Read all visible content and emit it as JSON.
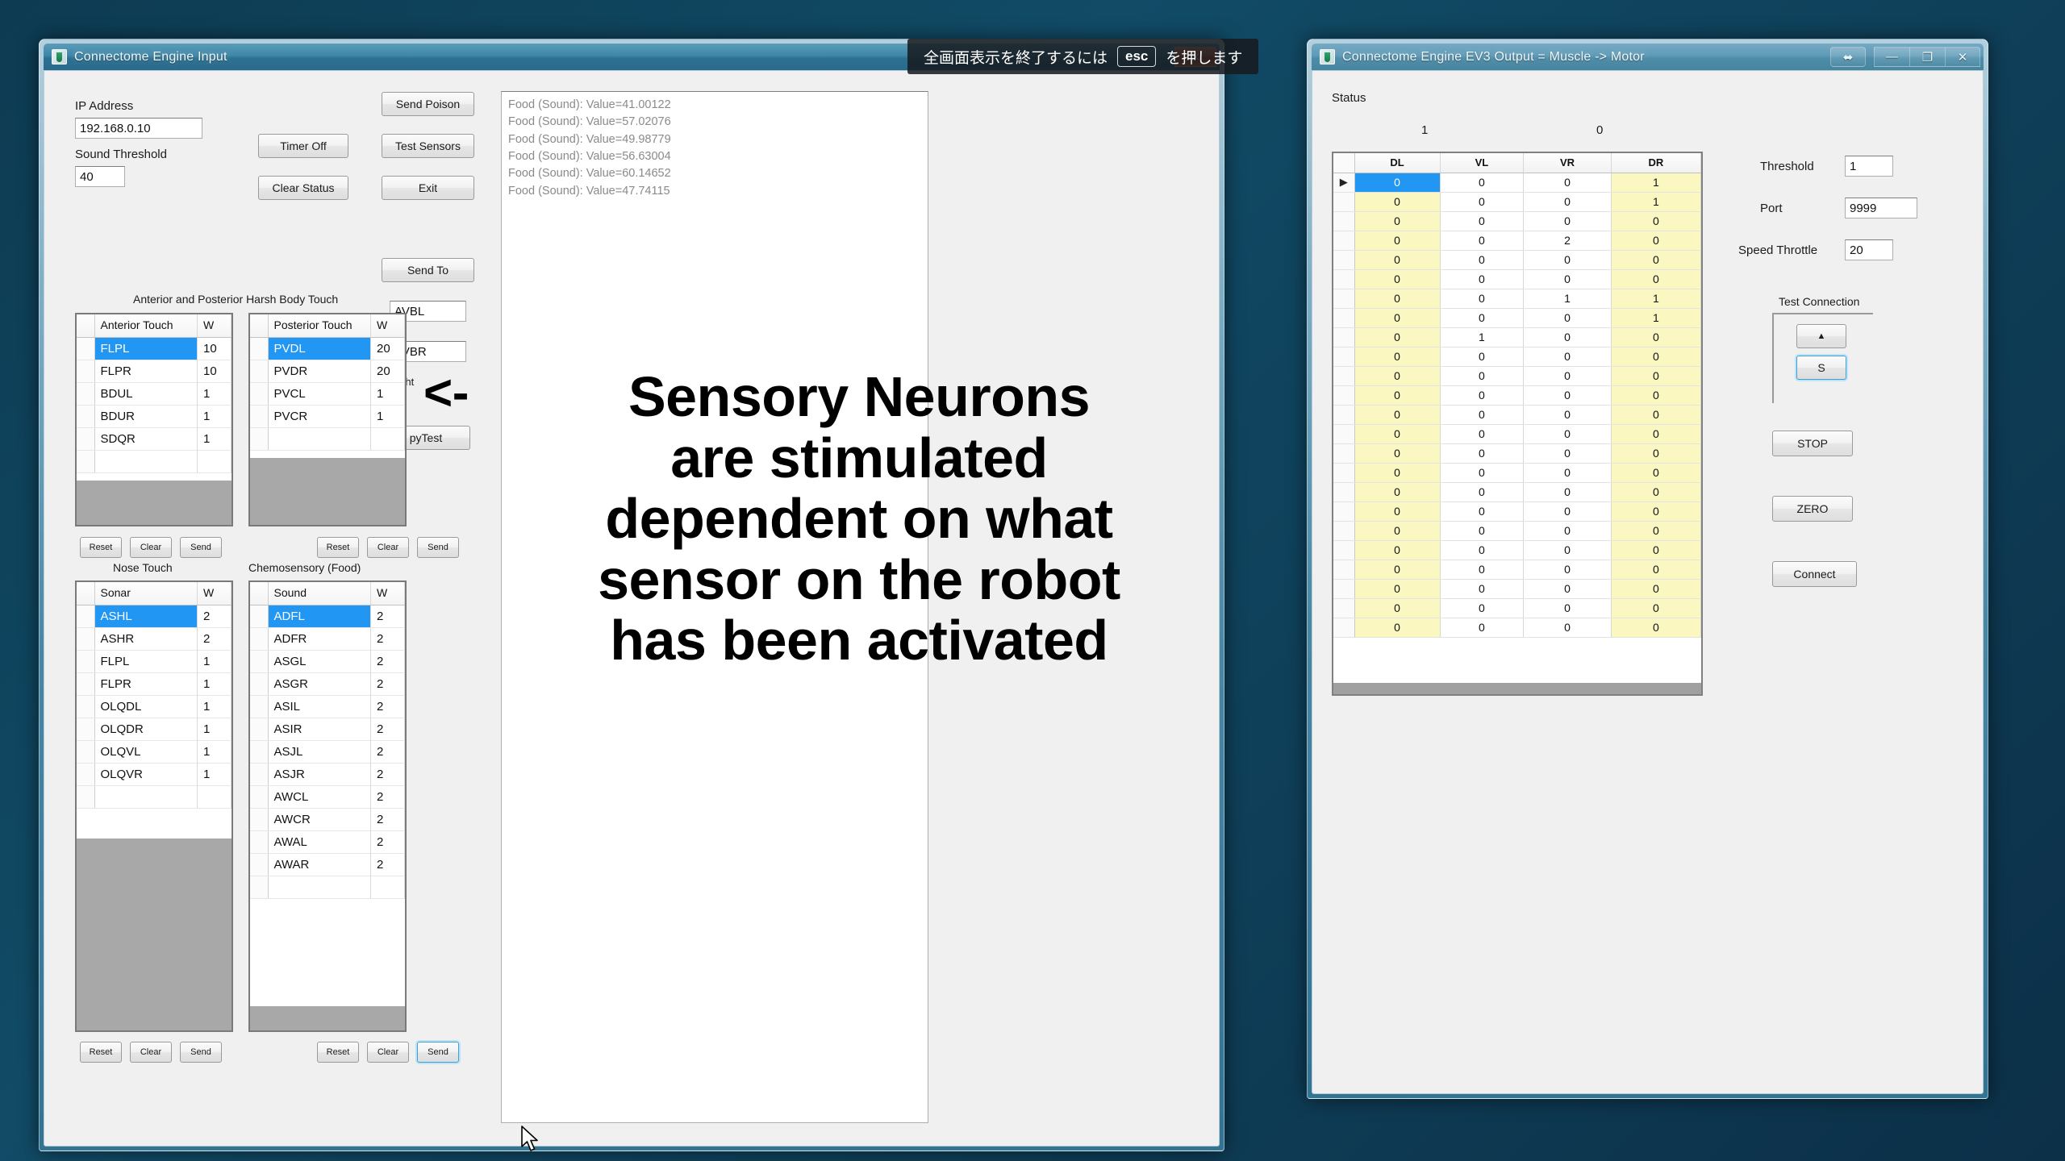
{
  "desktop": {
    "background": "#0f4360"
  },
  "esc_banner": {
    "before": "全画面表示を終了するには",
    "key": "esc",
    "after": "を押します"
  },
  "annotation": {
    "arrow": "<-",
    "line1": "Sensory Neurons",
    "line2": "are stimulated",
    "line3": "dependent on what",
    "line4": "sensor on the robot",
    "line5": "has been activated"
  },
  "input_window": {
    "title": "Connectome Engine Input",
    "titlebar_buttons": {
      "close": "✕"
    },
    "ip_label": "IP Address",
    "ip_value": "192.168.0.10",
    "sound_threshold_label": "Sound Threshold",
    "sound_threshold_value": "40",
    "buttons": {
      "timer_off": "Timer Off",
      "clear_status": "Clear Status",
      "send_poison": "Send Poison",
      "test_sensors": "Test Sensors",
      "exit": "Exit",
      "send_to": "Send To",
      "pytest": "pyTest"
    },
    "send_to_neuron": "AVBL",
    "send_to_neuron2": "AVBR",
    "weight_label": "Weight",
    "status_log": [
      "Food (Sound): Value=41.00122",
      "Food (Sound): Value=57.02076",
      "Food (Sound): Value=49.98779",
      "Food (Sound): Value=56.63004",
      "Food (Sound): Value=60.14652",
      "Food (Sound): Value=47.74115"
    ],
    "section_titles": {
      "harsh_touch": "Anterior and Posterior Harsh Body Touch",
      "nose_touch": "Nose Touch",
      "chemosensory": "Chemosensory (Food)"
    },
    "row_buttons": {
      "reset": "Reset",
      "clear": "Clear",
      "send": "Send"
    },
    "tables": {
      "anterior": {
        "headers": [
          "Anterior Touch",
          "W"
        ],
        "rows": [
          {
            "name": "FLPL",
            "w": "10",
            "selected": true
          },
          {
            "name": "FLPR",
            "w": "10",
            "selected": false
          },
          {
            "name": "BDUL",
            "w": "1",
            "selected": false
          },
          {
            "name": "BDUR",
            "w": "1",
            "selected": false
          },
          {
            "name": "SDQR",
            "w": "1",
            "selected": false
          }
        ]
      },
      "posterior": {
        "headers": [
          "Posterior Touch",
          "W"
        ],
        "rows": [
          {
            "name": "PVDL",
            "w": "20",
            "selected": true
          },
          {
            "name": "PVDR",
            "w": "20",
            "selected": false
          },
          {
            "name": "PVCL",
            "w": "1",
            "selected": false
          },
          {
            "name": "PVCR",
            "w": "1",
            "selected": false
          }
        ]
      },
      "sonar": {
        "headers": [
          "Sonar",
          "W"
        ],
        "rows": [
          {
            "name": "ASHL",
            "w": "2",
            "selected": true
          },
          {
            "name": "ASHR",
            "w": "2",
            "selected": false
          },
          {
            "name": "FLPL",
            "w": "1",
            "selected": false
          },
          {
            "name": "FLPR",
            "w": "1",
            "selected": false
          },
          {
            "name": "OLQDL",
            "w": "1",
            "selected": false
          },
          {
            "name": "OLQDR",
            "w": "1",
            "selected": false
          },
          {
            "name": "OLQVL",
            "w": "1",
            "selected": false
          },
          {
            "name": "OLQVR",
            "w": "1",
            "selected": false
          }
        ]
      },
      "sound": {
        "headers": [
          "Sound",
          "W"
        ],
        "rows": [
          {
            "name": "ADFL",
            "w": "2",
            "selected": true
          },
          {
            "name": "ADFR",
            "w": "2",
            "selected": false
          },
          {
            "name": "ASGL",
            "w": "2",
            "selected": false
          },
          {
            "name": "ASGR",
            "w": "2",
            "selected": false
          },
          {
            "name": "ASIL",
            "w": "2",
            "selected": false
          },
          {
            "name": "ASIR",
            "w": "2",
            "selected": false
          },
          {
            "name": "ASJL",
            "w": "2",
            "selected": false
          },
          {
            "name": "ASJR",
            "w": "2",
            "selected": false
          },
          {
            "name": "AWCL",
            "w": "2",
            "selected": false
          },
          {
            "name": "AWCR",
            "w": "2",
            "selected": false
          },
          {
            "name": "AWAL",
            "w": "2",
            "selected": false
          },
          {
            "name": "AWAR",
            "w": "2",
            "selected": false
          }
        ]
      }
    }
  },
  "output_window": {
    "title": "Connectome Engine EV3 Output = Muscle -> Motor",
    "titlebar_buttons": {
      "restore_down": "⬌",
      "minimize": "—",
      "maximize": "❐",
      "close": "✕"
    },
    "status_label": "Status",
    "status_values": [
      "1",
      "0"
    ],
    "grid": {
      "columns": [
        "DL",
        "VL",
        "VR",
        "DR"
      ],
      "selected_cell": {
        "row": 0,
        "col": 0
      },
      "rows": [
        [
          "0",
          "0",
          "0",
          "1"
        ],
        [
          "0",
          "0",
          "0",
          "1"
        ],
        [
          "0",
          "0",
          "0",
          "0"
        ],
        [
          "0",
          "0",
          "2",
          "0"
        ],
        [
          "0",
          "0",
          "0",
          "0"
        ],
        [
          "0",
          "0",
          "0",
          "0"
        ],
        [
          "0",
          "0",
          "1",
          "1"
        ],
        [
          "0",
          "0",
          "0",
          "1"
        ],
        [
          "0",
          "1",
          "0",
          "0"
        ],
        [
          "0",
          "0",
          "0",
          "0"
        ],
        [
          "0",
          "0",
          "0",
          "0"
        ],
        [
          "0",
          "0",
          "0",
          "0"
        ],
        [
          "0",
          "0",
          "0",
          "0"
        ],
        [
          "0",
          "0",
          "0",
          "0"
        ],
        [
          "0",
          "0",
          "0",
          "0"
        ],
        [
          "0",
          "0",
          "0",
          "0"
        ],
        [
          "0",
          "0",
          "0",
          "0"
        ],
        [
          "0",
          "0",
          "0",
          "0"
        ],
        [
          "0",
          "0",
          "0",
          "0"
        ],
        [
          "0",
          "0",
          "0",
          "0"
        ],
        [
          "0",
          "0",
          "0",
          "0"
        ],
        [
          "0",
          "0",
          "0",
          "0"
        ],
        [
          "0",
          "0",
          "0",
          "0"
        ],
        [
          "0",
          "0",
          "0",
          "0"
        ]
      ]
    },
    "fields": {
      "threshold_label": "Threshold",
      "threshold_value": "1",
      "port_label": "Port",
      "port_value": "9999",
      "speed_label": "Speed Throttle",
      "speed_value": "20"
    },
    "test_connection_label": "Test Connection",
    "buttons": {
      "up": "▲",
      "s": "S",
      "stop": "STOP",
      "zero": "ZERO",
      "connect": "Connect"
    }
  }
}
